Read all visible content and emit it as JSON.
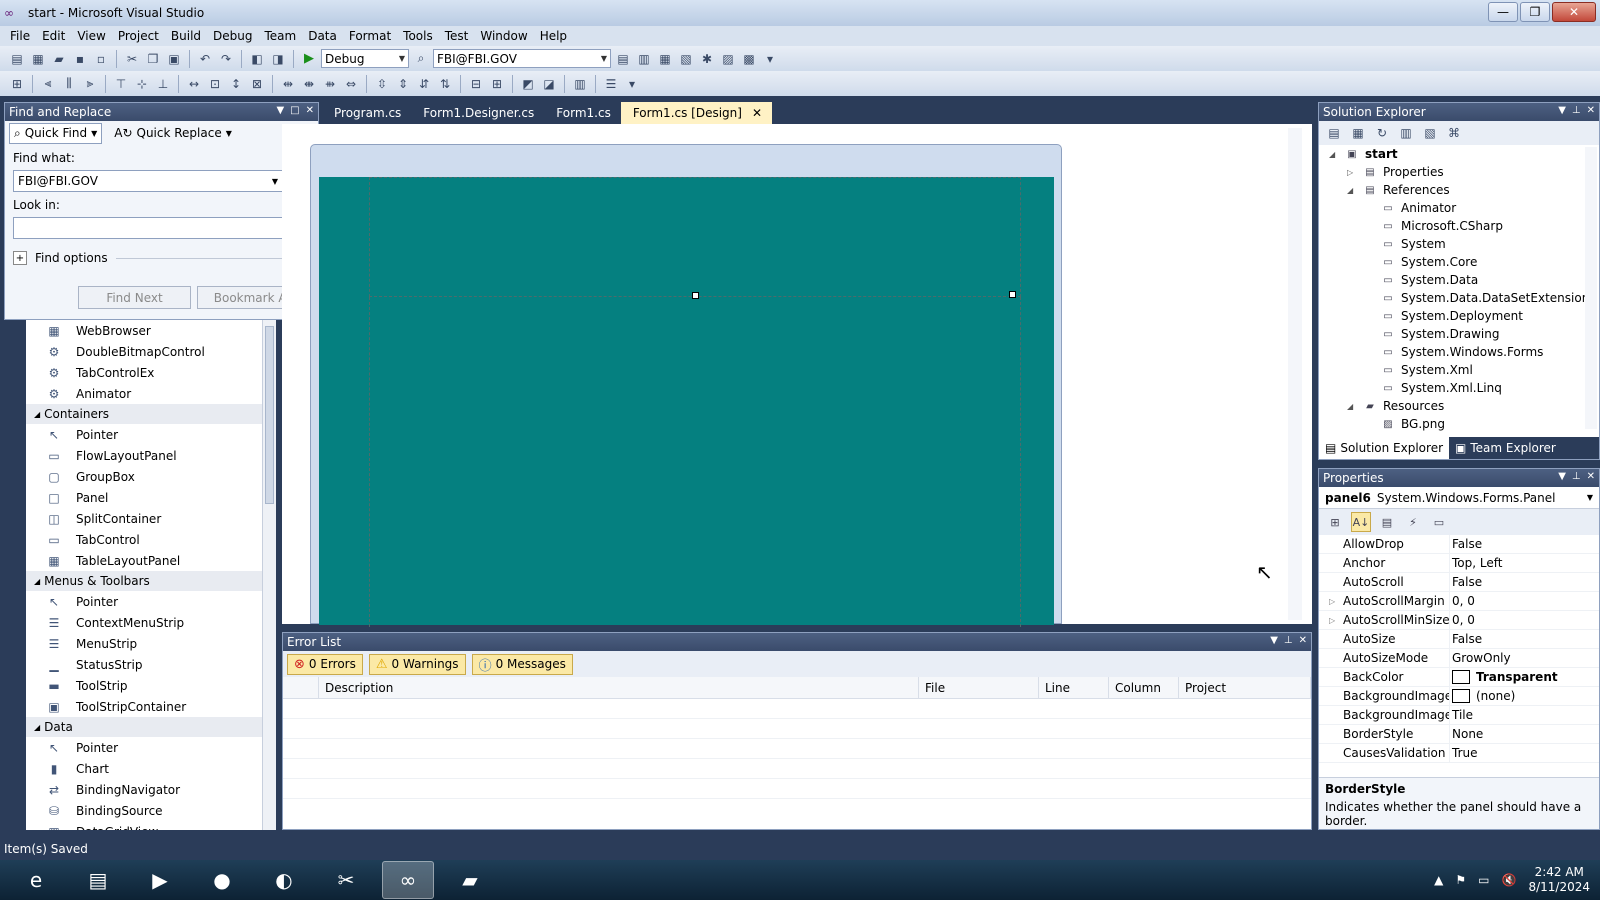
{
  "window": {
    "title": "start - Microsoft Visual Studio",
    "controls": [
      "—",
      "❐",
      "✕"
    ]
  },
  "menu": [
    "File",
    "Edit",
    "View",
    "Project",
    "Build",
    "Debug",
    "Team",
    "Data",
    "Format",
    "Tools",
    "Test",
    "Window",
    "Help"
  ],
  "toolbar": {
    "config": "Debug",
    "search_combo": "FBI@FBI.GOV"
  },
  "find_replace": {
    "title": "Find and Replace",
    "quick_find": "Quick Find",
    "quick_replace": "Quick Replace",
    "find_what_label": "Find what:",
    "find_what_value": "FBI@FBI.GOV",
    "look_in_label": "Look in:",
    "look_in_value": "",
    "find_options": "Find options",
    "find_next": "Find Next",
    "bookmark_all": "Bookmark All"
  },
  "toolbox": {
    "rows": [
      {
        "type": "item",
        "label": "WebBrowser",
        "icon": "▦"
      },
      {
        "type": "item",
        "label": "DoubleBitmapControl",
        "icon": "⚙"
      },
      {
        "type": "item",
        "label": "TabControlEx",
        "icon": "⚙"
      },
      {
        "type": "item",
        "label": "Animator",
        "icon": "⚙"
      },
      {
        "type": "cat",
        "label": "Containers"
      },
      {
        "type": "item",
        "label": "Pointer",
        "icon": "↖"
      },
      {
        "type": "item",
        "label": "FlowLayoutPanel",
        "icon": "▭"
      },
      {
        "type": "item",
        "label": "GroupBox",
        "icon": "▢"
      },
      {
        "type": "item",
        "label": "Panel",
        "icon": "□"
      },
      {
        "type": "item",
        "label": "SplitContainer",
        "icon": "◫"
      },
      {
        "type": "item",
        "label": "TabControl",
        "icon": "▭"
      },
      {
        "type": "item",
        "label": "TableLayoutPanel",
        "icon": "▦"
      },
      {
        "type": "cat",
        "label": "Menus & Toolbars"
      },
      {
        "type": "item",
        "label": "Pointer",
        "icon": "↖"
      },
      {
        "type": "item",
        "label": "ContextMenuStrip",
        "icon": "☰"
      },
      {
        "type": "item",
        "label": "MenuStrip",
        "icon": "☰"
      },
      {
        "type": "item",
        "label": "StatusStrip",
        "icon": "▁"
      },
      {
        "type": "item",
        "label": "ToolStrip",
        "icon": "▬"
      },
      {
        "type": "item",
        "label": "ToolStripContainer",
        "icon": "▣"
      },
      {
        "type": "cat",
        "label": "Data"
      },
      {
        "type": "item",
        "label": "Pointer",
        "icon": "↖"
      },
      {
        "type": "item",
        "label": "Chart",
        "icon": "▮"
      },
      {
        "type": "item",
        "label": "BindingNavigator",
        "icon": "⇄"
      },
      {
        "type": "item",
        "label": "BindingSource",
        "icon": "⛁"
      },
      {
        "type": "item",
        "label": "DataGridView",
        "icon": "▦"
      }
    ]
  },
  "tabs": [
    {
      "label": "Program.cs",
      "active": false
    },
    {
      "label": "Form1.Designer.cs",
      "active": false
    },
    {
      "label": "Form1.cs",
      "active": false
    },
    {
      "label": "Form1.cs [Design]",
      "active": true
    }
  ],
  "designer": {
    "form_color": "#058080"
  },
  "error_list": {
    "title": "Error List",
    "errors": "0 Errors",
    "warnings": "0 Warnings",
    "messages": "0 Messages",
    "columns": [
      "",
      "Description",
      "File",
      "Line",
      "Column",
      "Project"
    ]
  },
  "solution_explorer": {
    "title": "Solution Explorer",
    "tree": [
      {
        "label": "start",
        "level": 0,
        "twisty": "◢",
        "icon": "▣",
        "bold": true
      },
      {
        "label": "Properties",
        "level": 1,
        "twisty": "▷",
        "icon": "▤"
      },
      {
        "label": "References",
        "level": 1,
        "twisty": "◢",
        "icon": "▤"
      },
      {
        "label": "Animator",
        "level": 2,
        "twisty": "",
        "icon": "▭"
      },
      {
        "label": "Microsoft.CSharp",
        "level": 2,
        "twisty": "",
        "icon": "▭"
      },
      {
        "label": "System",
        "level": 2,
        "twisty": "",
        "icon": "▭"
      },
      {
        "label": "System.Core",
        "level": 2,
        "twisty": "",
        "icon": "▭"
      },
      {
        "label": "System.Data",
        "level": 2,
        "twisty": "",
        "icon": "▭"
      },
      {
        "label": "System.Data.DataSetExtensions",
        "level": 2,
        "twisty": "",
        "icon": "▭"
      },
      {
        "label": "System.Deployment",
        "level": 2,
        "twisty": "",
        "icon": "▭"
      },
      {
        "label": "System.Drawing",
        "level": 2,
        "twisty": "",
        "icon": "▭"
      },
      {
        "label": "System.Windows.Forms",
        "level": 2,
        "twisty": "",
        "icon": "▭"
      },
      {
        "label": "System.Xml",
        "level": 2,
        "twisty": "",
        "icon": "▭"
      },
      {
        "label": "System.Xml.Linq",
        "level": 2,
        "twisty": "",
        "icon": "▭"
      },
      {
        "label": "Resources",
        "level": 1,
        "twisty": "◢",
        "icon": "▰"
      },
      {
        "label": "BG.png",
        "level": 2,
        "twisty": "",
        "icon": "▨"
      }
    ],
    "bottom_tabs": [
      "Solution Explorer",
      "Team Explorer"
    ]
  },
  "properties": {
    "title": "Properties",
    "object_name": "panel6",
    "object_type": "System.Windows.Forms.Panel",
    "rows": [
      {
        "name": "AllowDrop",
        "value": "False",
        "expandable": false
      },
      {
        "name": "Anchor",
        "value": "Top, Left",
        "expandable": false
      },
      {
        "name": "AutoScroll",
        "value": "False",
        "expandable": false
      },
      {
        "name": "AutoScrollMargin",
        "value": "0, 0",
        "expandable": true
      },
      {
        "name": "AutoScrollMinSize",
        "value": "0, 0",
        "expandable": true
      },
      {
        "name": "AutoSize",
        "value": "False",
        "expandable": false
      },
      {
        "name": "AutoSizeMode",
        "value": "GrowOnly",
        "expandable": false
      },
      {
        "name": "BackColor",
        "value": "Transparent",
        "expandable": false,
        "swatch": true,
        "bold": true
      },
      {
        "name": "BackgroundImage",
        "value": "(none)",
        "expandable": false,
        "swatch": true
      },
      {
        "name": "BackgroundImageLayout",
        "value": "Tile",
        "expandable": false
      },
      {
        "name": "BorderStyle",
        "value": "None",
        "expandable": false
      },
      {
        "name": "CausesValidation",
        "value": "True",
        "expandable": false
      }
    ],
    "description_title": "BorderStyle",
    "description_text": "Indicates whether the panel should have a border."
  },
  "status_text": "Item(s) Saved",
  "taskbar": {
    "apps": [
      "e",
      "▤",
      "▶",
      "●",
      "◐",
      "✂",
      "∞",
      "▰"
    ],
    "active_index": 6,
    "time": "2:42 AM",
    "date": "8/11/2024"
  }
}
